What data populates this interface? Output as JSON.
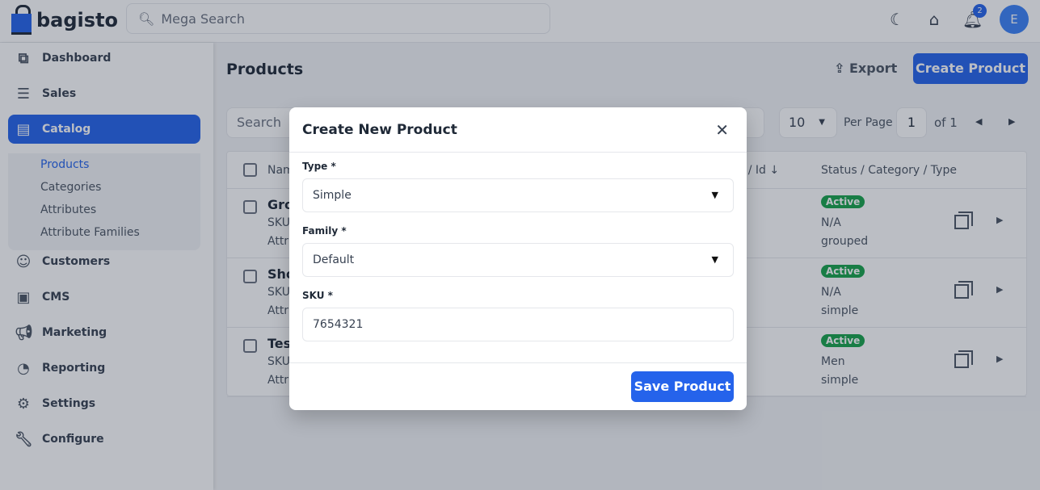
{
  "header": {
    "logo": "bagisto",
    "search_placeholder": "Mega Search",
    "notification_count": "2",
    "avatar_initial": "E"
  },
  "sidebar": {
    "items": [
      {
        "label": "Dashboard",
        "icon": "dashboard-icon"
      },
      {
        "label": "Sales",
        "icon": "sales-icon"
      },
      {
        "label": "Catalog",
        "icon": "catalog-icon",
        "active": true
      },
      {
        "label": "Customers",
        "icon": "customers-icon"
      },
      {
        "label": "CMS",
        "icon": "cms-icon"
      },
      {
        "label": "Marketing",
        "icon": "marketing-icon"
      },
      {
        "label": "Reporting",
        "icon": "reporting-icon"
      },
      {
        "label": "Settings",
        "icon": "settings-icon"
      },
      {
        "label": "Configure",
        "icon": "configure-icon"
      }
    ],
    "catalog_sub": [
      "Products",
      "Categories",
      "Attributes",
      "Attribute Families"
    ]
  },
  "main": {
    "title": "Products",
    "export_label": "Export",
    "create_label": "Create Product",
    "search_placeholder": "Search",
    "per_page_value": "10",
    "per_page_label": "Per Page",
    "page": "1",
    "of_pages": "of 1",
    "columns": {
      "name": "Nam",
      "id": "y / Id",
      "status": "Status / Category / Type"
    },
    "rows": [
      {
        "name": "Gro",
        "sku": "SKU",
        "attr": "Attr",
        "status": "Active",
        "category": "N/A",
        "type": "grouped"
      },
      {
        "name": "Sho",
        "sku": "SKU",
        "attr": "Attr",
        "status": "Active",
        "category": "N/A",
        "type": "simple"
      },
      {
        "name": "Tes",
        "sku": "SKU",
        "attr": "Attr",
        "status": "Active",
        "category": "Men",
        "type": "simple"
      }
    ]
  },
  "modal": {
    "title": "Create New Product",
    "type_label": "Type *",
    "type_value": "Simple",
    "family_label": "Family *",
    "family_value": "Default",
    "sku_label": "SKU *",
    "sku_value": "7654321",
    "save_label": "Save Product"
  },
  "colors": {
    "primary": "#2563eb",
    "active_badge": "#16a34a"
  }
}
